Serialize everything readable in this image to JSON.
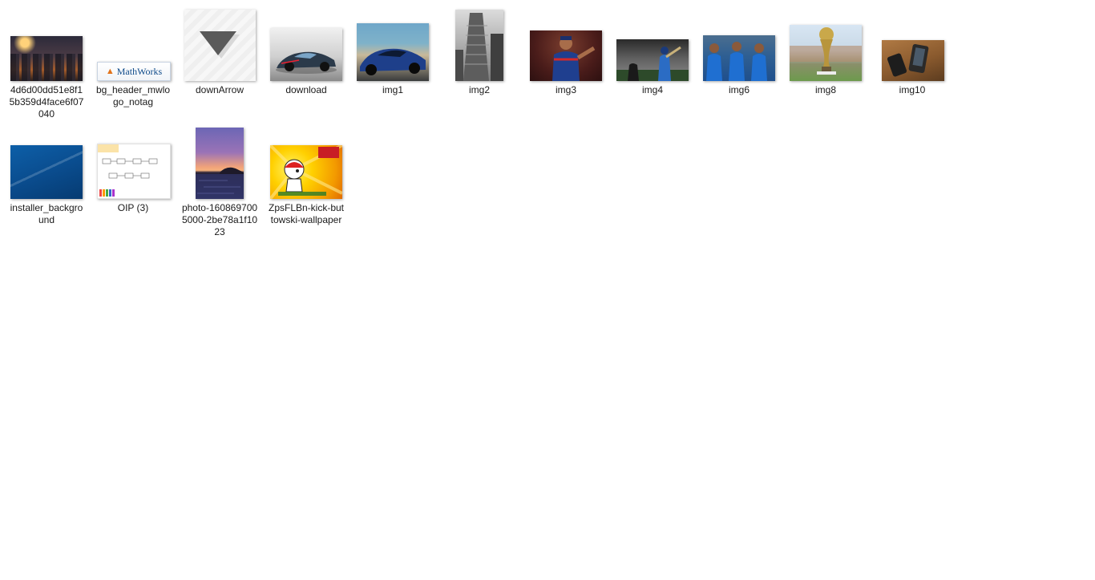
{
  "files": [
    {
      "name": "4d6d00dd51e8f15b359d4face6f07040",
      "icon": "city-night-thumbnail"
    },
    {
      "name": "bg_header_mwlogo_notag",
      "icon": "mathworks-logo-thumbnail",
      "logo_text": "MathWorks"
    },
    {
      "name": "downArrow",
      "icon": "down-arrow-thumbnail"
    },
    {
      "name": "download",
      "icon": "sports-car-thumbnail"
    },
    {
      "name": "img1",
      "icon": "blue-sports-car-thumbnail"
    },
    {
      "name": "img2",
      "icon": "building-thumbnail"
    },
    {
      "name": "img3",
      "icon": "cricket-player-thumbnail"
    },
    {
      "name": "img4",
      "icon": "cricket-batsman-thumbnail"
    },
    {
      "name": "img6",
      "icon": "cricket-team-thumbnail"
    },
    {
      "name": "img8",
      "icon": "world-cup-trophy-thumbnail"
    },
    {
      "name": "img10",
      "icon": "smartphones-thumbnail"
    },
    {
      "name": "installer_background",
      "icon": "blue-background-thumbnail"
    },
    {
      "name": "OIP (3)",
      "icon": "diagram-thumbnail"
    },
    {
      "name": "photo-1608697005000-2be78a1f1023",
      "icon": "sunset-thumbnail"
    },
    {
      "name": "ZpsFLBn-kick-buttowski-wallpaper",
      "icon": "cartoon-wallpaper-thumbnail"
    }
  ],
  "colors": {
    "background": "#ffffff",
    "label_text": "#1a1a1a"
  }
}
